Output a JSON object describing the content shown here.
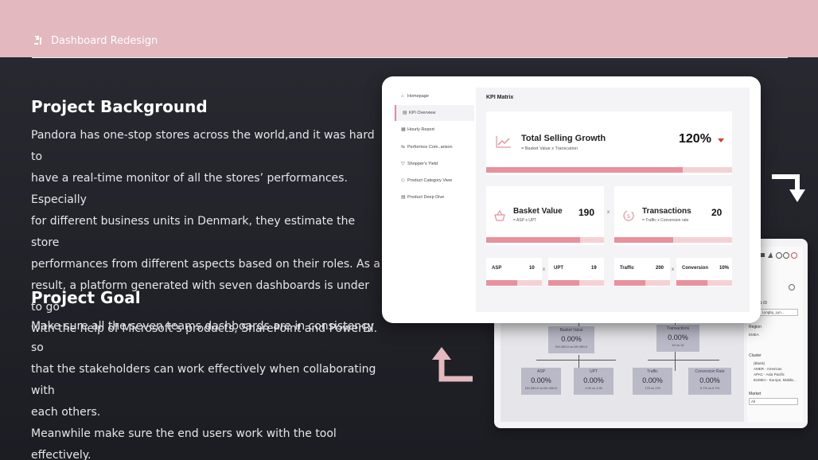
{
  "header": {
    "title": "Dashboard Redesign"
  },
  "background": {
    "heading": "Project Background",
    "lines": [
      "Pandora has one-stop stores across the world,and it was hard to",
      "have a real-time monitor of all the stores’ performances. Especially",
      "for different business units in Denmark, they estimate the store",
      "performances from different aspects based on their roles. As a",
      "result, a platform generated with seven dashboards is under to go",
      "with the help of Microsoft’s products, SharePoint and PowerBI."
    ]
  },
  "goal": {
    "heading": "Project Goal",
    "lines": [
      "Make sure all the seven teams dashboards are in consistency so",
      "that the stakeholders can work effectively when collaborating with",
      "each others.",
      "Meanwhile make sure the end users work with the tool effectively."
    ]
  },
  "dashboard": {
    "nav": [
      {
        "label": "Homepage",
        "icon": "⌂"
      },
      {
        "label": "KPI Overview",
        "icon": "▤"
      },
      {
        "label": "Hourly Report",
        "icon": "▦"
      },
      {
        "label": "Performce Com..arison",
        "icon": "⇆"
      },
      {
        "label": "Shopper's Yield",
        "icon": "▽"
      },
      {
        "label": "Product Category View",
        "icon": "◇"
      },
      {
        "label": "Product Deep Dive",
        "icon": "▤"
      }
    ],
    "section_title": "KPI Matrix",
    "tsg": {
      "title": "Total Selling Growth",
      "sub": "= Basket Value x Transcation",
      "value": "120%",
      "progress": 0.8
    },
    "basket": {
      "title": "Basket Value",
      "sub": "= ASP x UPT",
      "value": "190",
      "progress": 0.8
    },
    "transactions": {
      "title": "Transactions",
      "sub": "= Traffic x Conversion rate",
      "value": "20",
      "progress": 0.5
    },
    "small": [
      {
        "title": "ASP",
        "value": "10",
        "progress": 0.55
      },
      {
        "title": "UPT",
        "value": "19",
        "progress": 0.55
      },
      {
        "title": "Traffic",
        "value": "200",
        "progress": 0.55
      },
      {
        "title": "Conversion",
        "value": "10%",
        "progress": 0.55
      }
    ],
    "times": "x"
  },
  "back_dashboard": {
    "boxes": [
      {
        "label": "Basket Value",
        "value": "0.00%",
        "sub": "DH 450.0 vs DH 450.0"
      },
      {
        "label": "Transactions",
        "value": "0.00%",
        "sub": "10 vs 10"
      },
      {
        "label": "ASP",
        "value": "0.00%",
        "sub": "DH 450.0 vs DH 450.0"
      },
      {
        "label": "UPT",
        "value": "0.00%",
        "sub": "1.00 vs 1.00"
      },
      {
        "label": "Traffic",
        "value": "0.00%",
        "sub": "175 vs 175"
      },
      {
        "label": "Conversion Rate",
        "value": "0.00%",
        "sub": "5.7% vs 5.7%"
      }
    ],
    "filters": {
      "store_label": "Store & ID",
      "store_value": "1_Sjk. Lyngby_Lyn...",
      "region_label": "Region",
      "region_value": "EMEA",
      "cluster_label": "Cluster",
      "cluster_items": [
        "(Blank)",
        "AMER - Americas",
        "APAC - Asia Pacific",
        "EUMEA - Europe, Middle..."
      ],
      "market_label": "Market",
      "market_value": "All"
    }
  }
}
